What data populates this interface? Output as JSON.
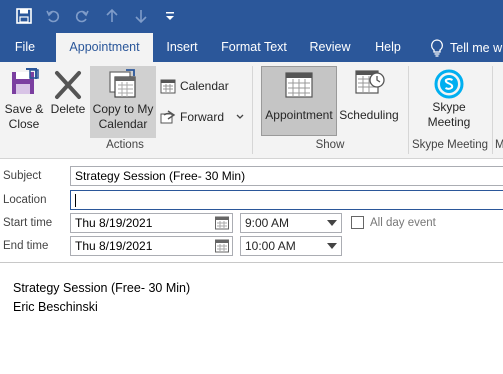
{
  "quick_access": {
    "icons": [
      "save-icon",
      "undo-icon",
      "redo-icon",
      "up-arrow-icon",
      "down-arrow-icon",
      "customize-icon"
    ]
  },
  "tabs": [
    {
      "label": "File"
    },
    {
      "label": "Appointment",
      "active": true
    },
    {
      "label": "Insert"
    },
    {
      "label": "Format Text"
    },
    {
      "label": "Review"
    },
    {
      "label": "Help"
    }
  ],
  "tell_me": "Tell me w",
  "ribbon": {
    "save_close": "Save & Close",
    "save_line1": "Save &",
    "save_line2": "Close",
    "delete": "Delete",
    "copy_line1": "Copy to My",
    "copy_line2": "Calendar",
    "calendar": "Calendar",
    "forward": "Forward",
    "actions_group": "Actions",
    "appointment": "Appointment",
    "scheduling": "Scheduling",
    "show_group": "Show",
    "skype_line1": "Skype",
    "skype_line2": "Meeting",
    "skype_group": "Skype Meeting",
    "overflow_group": "M"
  },
  "form": {
    "subject_label": "Subject",
    "subject_value": "Strategy Session (Free- 30 Min)",
    "location_label": "Location",
    "location_value": "",
    "start_label": "Start time",
    "start_date": "Thu 8/19/2021",
    "start_time": "9:00 AM",
    "all_day_label": "All day event",
    "end_label": "End time",
    "end_date": "Thu 8/19/2021",
    "end_time": "10:00 AM"
  },
  "body_text": {
    "line1": "Strategy Session (Free- 30 Min)",
    "line2": "Eric Beschinski"
  },
  "colors": {
    "accent": "#2b579a",
    "ribbon_bg": "#f3f3f3",
    "skype_blue": "#00aff0",
    "save_purple": "#7b3fa0"
  }
}
